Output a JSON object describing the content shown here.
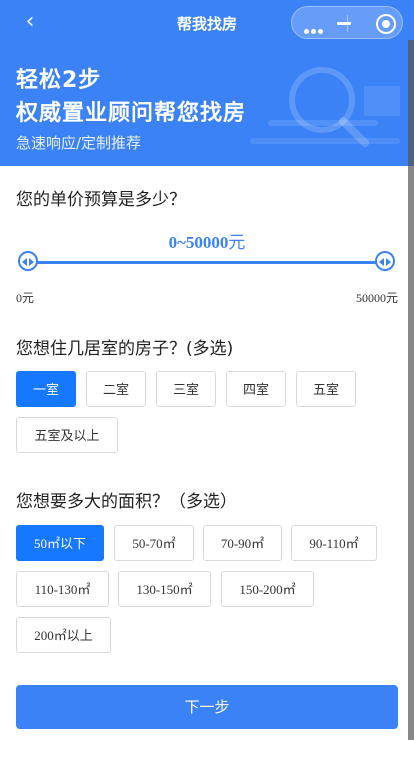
{
  "nav": {
    "back_icon": "‹",
    "title": "帮我找房"
  },
  "header": {
    "title_line1": "轻松2步",
    "title_line2": "权威置业顾问帮您找房",
    "subtitle": "急速响应/定制推荐"
  },
  "budget": {
    "question": "您的单价预算是多少？",
    "range_text": "0~50000",
    "range_unit": "元",
    "min_label": "0元",
    "max_label": "50000元",
    "selected_min": 0,
    "selected_max": 50000
  },
  "rooms": {
    "question": "您想住几居室的房子？(多选)",
    "options": [
      "一室",
      "二室",
      "三室",
      "四室",
      "五室",
      "五室及以上"
    ],
    "selected": [
      0
    ]
  },
  "area": {
    "question": "您想要多大的面积？（多选）",
    "options": [
      "50㎡以下",
      "50-70㎡",
      "70-90㎡",
      "90-110㎡",
      "110-130㎡",
      "130-150㎡",
      "150-200㎡",
      "200㎡以上"
    ],
    "selected": [
      0
    ]
  },
  "next_label": "下一步",
  "colors": {
    "primary": "#3b82f6",
    "selected": "#1677ff"
  }
}
